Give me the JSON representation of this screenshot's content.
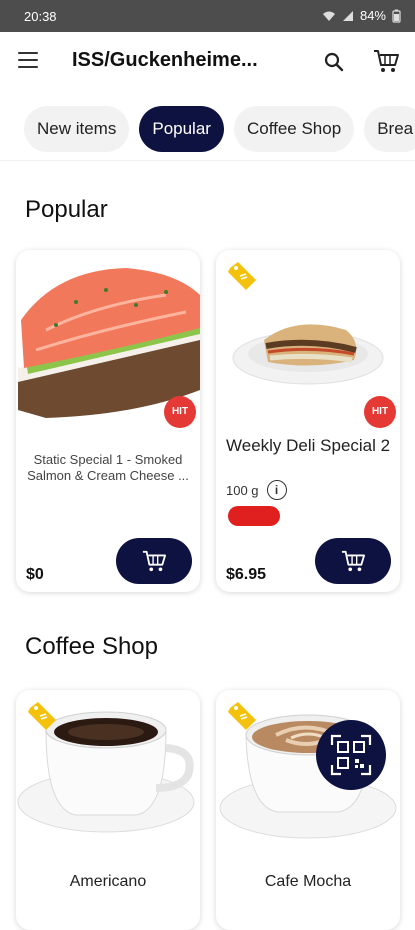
{
  "status": {
    "time": "20:38",
    "battery": "84%"
  },
  "header": {
    "title": "ISS/Guckenheime..."
  },
  "tabs": [
    {
      "label": "New items",
      "active": false
    },
    {
      "label": "Popular",
      "active": true
    },
    {
      "label": "Coffee Shop",
      "active": false
    },
    {
      "label": "Brea",
      "active": false
    }
  ],
  "sections": {
    "popular": {
      "title": "Popular",
      "products": [
        {
          "name": "Static Special 1 - Smoked Salmon & Cream Cheese ...",
          "price": "$0",
          "badge": "HIT"
        },
        {
          "name": "Weekly Deli Special 2",
          "weight": "100 g",
          "price": "$6.95",
          "badge": "HIT"
        }
      ]
    },
    "coffee": {
      "title": "Coffee Shop",
      "products": [
        {
          "name": "Americano"
        },
        {
          "name": "Cafe Mocha"
        }
      ]
    }
  },
  "colors": {
    "primary": "#0e1240",
    "hit": "#e53935",
    "tag": "#f4c20d",
    "statusbar": "#4d4d4d"
  },
  "icons": {
    "menu": "menu-icon",
    "search": "search-icon",
    "cart": "cart-icon",
    "tag": "price-tag-icon",
    "info": "info-icon",
    "qr": "qr-scan-icon"
  }
}
